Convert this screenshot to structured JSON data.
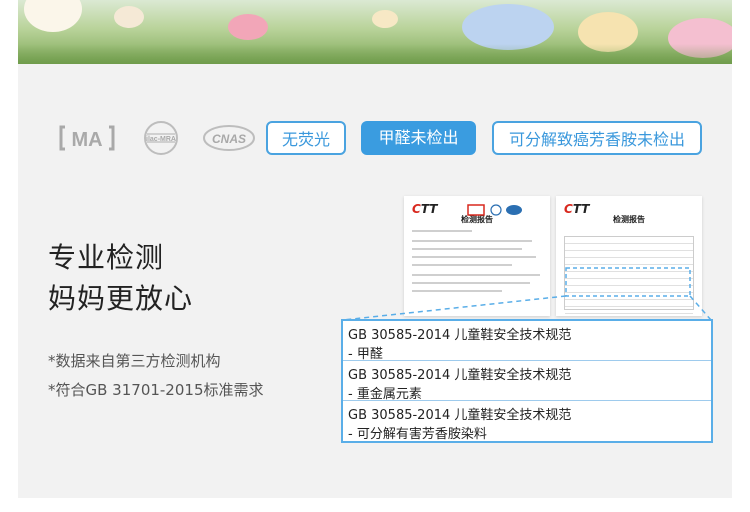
{
  "certifications": {
    "ma": "MA",
    "ilac": "ILAC-MRA",
    "cnas": "CNAS"
  },
  "tags": [
    "无荧光",
    "甲醛未检出",
    "可分解致癌芳香胺未检出"
  ],
  "headline": {
    "line1": "专业检测",
    "line2": "妈妈更放心"
  },
  "notes": {
    "note1": "*数据来自第三方检测机构",
    "note2": "*符合GB 31701-2015标准需求"
  },
  "reports": [
    {
      "logo": "CTT",
      "title": "检测报告"
    },
    {
      "logo": "CTT",
      "title": "检测报告"
    }
  ],
  "results": [
    {
      "standard": "GB 30585-2014  儿童鞋安全技术规范",
      "item": "-  甲醛"
    },
    {
      "standard": "GB 30585-2014  儿童鞋安全技术规范",
      "item": "-  重金属元素"
    },
    {
      "standard": "GB 30585-2014  儿童鞋安全技术规范",
      "item": "-  可分解有害芳香胺染料"
    }
  ],
  "colors": {
    "accent": "#3a9ce0",
    "panel": "#f2f2f2"
  }
}
